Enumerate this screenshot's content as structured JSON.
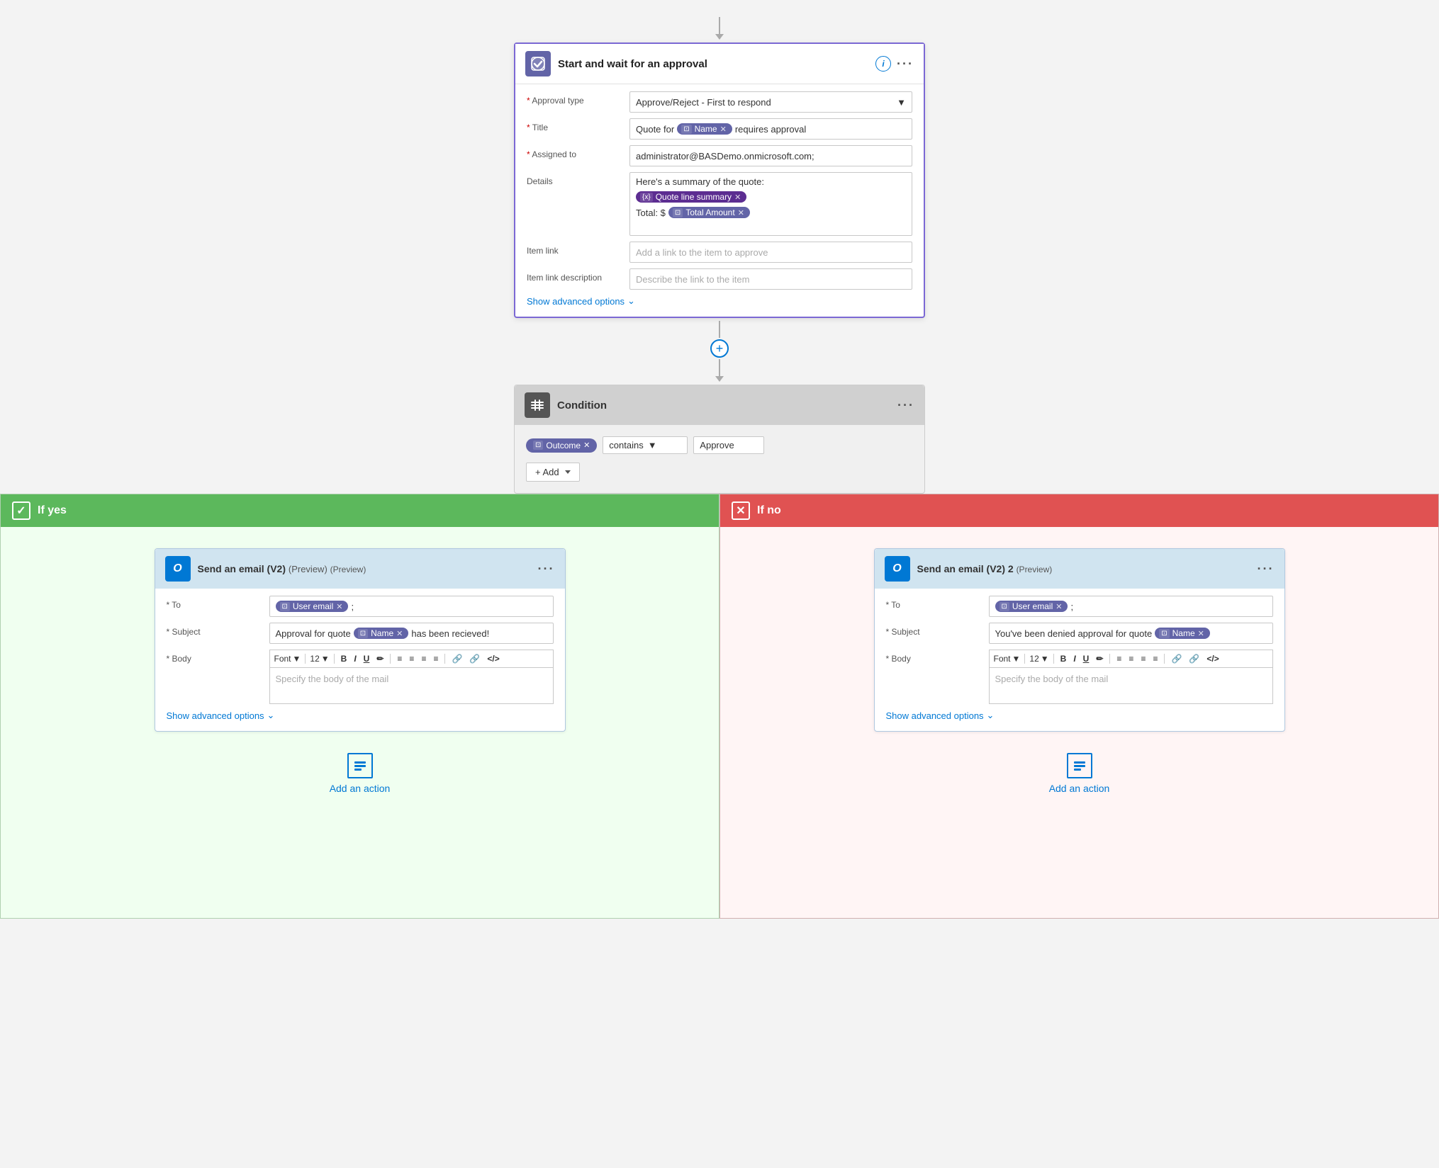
{
  "flow": {
    "top_arrow": "↓",
    "approval_card": {
      "icon_symbol": "✓",
      "title": "Start and wait for an approval",
      "info_label": "i",
      "menu_label": "···",
      "fields": {
        "approval_type": {
          "label": "* Approval type",
          "value": "Approve/Reject - First to respond",
          "required": true
        },
        "title": {
          "label": "* Title",
          "required": true,
          "prefix": "Quote for",
          "token1_label": "Name",
          "suffix": "requires approval"
        },
        "assigned_to": {
          "label": "* Assigned to",
          "required": true,
          "value": "administrator@BASDemo.onmicrosoft.com;"
        },
        "details": {
          "label": "Details",
          "line1": "Here's a summary of the quote:",
          "token1_label": "Quote line summary",
          "line2": "Total: $",
          "token2_label": "Total Amount"
        },
        "item_link": {
          "label": "Item link",
          "placeholder": "Add a link to the item to approve"
        },
        "item_link_desc": {
          "label": "Item link description",
          "placeholder": "Describe the link to the item"
        }
      },
      "show_advanced": "Show advanced options"
    },
    "plus_label": "+",
    "condition_card": {
      "icon_symbol": "⊟",
      "title": "Condition",
      "menu_label": "···",
      "condition": {
        "token_label": "Outcome",
        "operator": "contains",
        "value": "Approve"
      },
      "add_label": "+ Add"
    },
    "branch_yes": {
      "header_label": "If yes",
      "icon_symbol": "✓",
      "email_card": {
        "icon_symbol": "✉",
        "title": "Send an email (V2)",
        "title_suffix": "(Preview)",
        "menu_label": "···",
        "to_label": "* To",
        "to_token": "User email",
        "to_suffix": ";",
        "subject_label": "* Subject",
        "subject_prefix": "Approval for quote",
        "subject_token": "Name",
        "subject_suffix": "has been recieved!",
        "body_label": "* Body",
        "font_label": "Font",
        "font_size": "12",
        "body_placeholder": "Specify the body of the mail",
        "show_advanced": "Show advanced options",
        "toolbar_items": [
          "B",
          "I",
          "U",
          "✏",
          "≡",
          "≡",
          "≡",
          "≡",
          "🔗",
          "🔗",
          "</>"
        ]
      },
      "add_action_label": "Add an action"
    },
    "branch_no": {
      "header_label": "If no",
      "icon_symbol": "✕",
      "email_card": {
        "icon_symbol": "✉",
        "title": "Send an email (V2) 2",
        "title_suffix": "(Preview)",
        "menu_label": "···",
        "to_label": "* To",
        "to_token": "User email",
        "to_suffix": ";",
        "subject_label": "* Subject",
        "subject_prefix": "You've been denied approval for quote",
        "subject_token": "Name",
        "body_label": "* Body",
        "font_label": "Font",
        "font_size": "12",
        "body_placeholder": "Specify the body of the mail",
        "show_advanced": "Show advanced options",
        "toolbar_items": [
          "B",
          "I",
          "U",
          "✏",
          "≡",
          "≡",
          "≡",
          "≡",
          "🔗",
          "🔗",
          "</>"
        ]
      },
      "add_action_label": "Add an action"
    }
  }
}
